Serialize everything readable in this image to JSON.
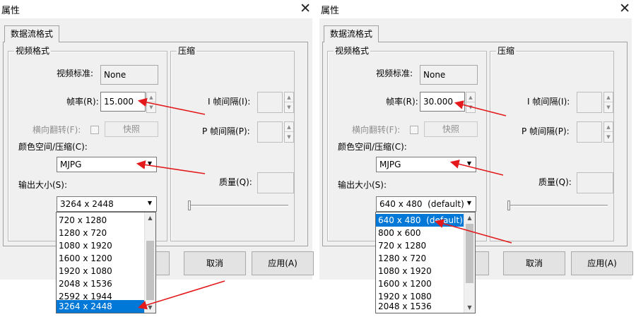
{
  "colors": {
    "annotation_arrow": "#e3191b",
    "selection": "#0078d7"
  },
  "left": {
    "window_title": "属性",
    "close_icon": "✕",
    "tab_label": "数据流格式",
    "video_format": {
      "title": "视频格式",
      "standard_label": "视频标准:",
      "standard_value": "None",
      "fps_label": "帧率(R):",
      "fps_value": "15.000",
      "flip_label": "横向翻转(F):",
      "snapshot_label": "快照",
      "colorspace_label": "颜色空间/压缩(C):",
      "colorspace_value": "MJPG",
      "output_size_label": "输出大小(S):",
      "output_size_value": "3264 x 2448"
    },
    "compression": {
      "title": "压缩",
      "iframe_label": "I 帧间隔(I):",
      "pframe_label": "P 帧间隔(P):",
      "quality_label": "质量(Q):"
    },
    "buttons": {
      "cancel": "取消",
      "apply": "应用(A)"
    },
    "dropdown": {
      "items": [
        "720 x 1280",
        "1280 x 720",
        "1080 x 1920",
        "1600 x 1200",
        "1920 x 1080",
        "2048 x 1536",
        "2592 x 1944",
        "3264 x 2448"
      ],
      "selected_index": 7
    }
  },
  "right": {
    "window_title": "属性",
    "close_icon": "✕",
    "tab_label": "数据流格式",
    "video_format": {
      "title": "视频格式",
      "standard_label": "视频标准:",
      "standard_value": "None",
      "fps_label": "帧率(R):",
      "fps_value": "30.000",
      "flip_label": "横向翻转(F):",
      "snapshot_label": "快照",
      "colorspace_label": "颜色空间/压缩(C):",
      "colorspace_value": "MJPG",
      "output_size_label": "输出大小(S):",
      "output_size_value": "640 x 480  (default)"
    },
    "compression": {
      "title": "压缩",
      "iframe_label": "I 帧间隔(I):",
      "pframe_label": "P 帧间隔(P):",
      "quality_label": "质量(Q):"
    },
    "buttons": {
      "cancel": "取消",
      "apply": "应用(A)"
    },
    "dropdown": {
      "items": [
        "640 x 480  (default)",
        "800 x 600",
        "720 x 1280",
        "1280 x 720",
        "1080 x 1920",
        "1600 x 1200",
        "1920 x 1080",
        "2048 x 1536"
      ],
      "selected_index": 0
    }
  }
}
